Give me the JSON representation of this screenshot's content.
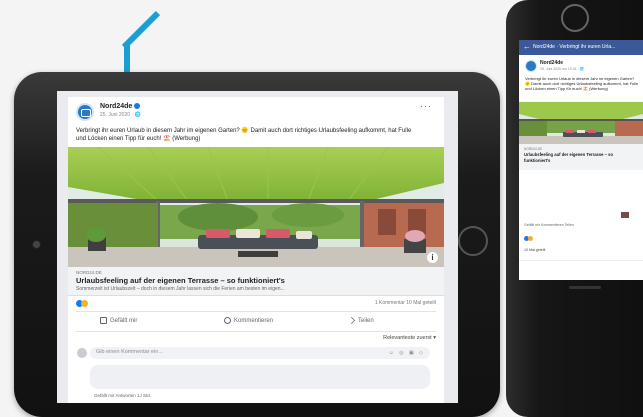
{
  "post": {
    "page_name": "Nord24de",
    "date": "25. Juni 2020 · 🌐",
    "menu_glyph": "···",
    "text": "Verbringt ihr euren Urlaub in diesem Jahr im eigenen Garten? 🌞 Damit auch dort richtiges Urlaubsfeeling aufkommt, hat Fulle und Löcken einen Tipp für euch! 🏖️ (Werbung)",
    "info_glyph": "i",
    "link": {
      "domain": "NORD24.DE",
      "title": "Urlaubsfeeling auf der eigenen Terrasse – so funktioniert's",
      "description": "Sommerzeit ist Urlaubszeit – doch in diesem Jahr lassen sich die Ferien am besten im eigen..."
    },
    "stats": "1 Kommentar  10 Mal geteilt",
    "actions": {
      "like": "Gefällt mir",
      "comment": "Kommentieren",
      "share": "Teilen"
    },
    "sort": "Relevanteste zuerst ▾",
    "comment_placeholder": "Gib einen Kommentar ein...",
    "comment_icons": "☺ ◎ ▣ ◇",
    "comment_meta": "Gefällt mir   Antworten   1J Std."
  },
  "phone": {
    "title": "Nord24de · Verbringt ihr euren Urla...",
    "back": "←",
    "page_name": "Nord24de",
    "date": "25. Juni 2020 um 10:31 · 🌐",
    "text": "Verbringt ihr euren Urlaub in diesem Jahr im eigenen Garten? 🌞 Damit auch dort richtiges Urlaubsfeeling aufkommt, hat Fulle und Löcken einen Tipp für euch! 🏖️ (Werbung)",
    "link_domain": "NORD24.DE",
    "link_title": "Urlaubsfeeling auf der eigenen Terrasse – so funktioniert's",
    "actions": "Gefällt mir   Kommentieren   Teilen",
    "shares": "10 Mal geteilt"
  },
  "colors": {
    "accent": "#1a9fd3",
    "facebook_blue": "#3b5998",
    "like_blue": "#1877f2"
  }
}
